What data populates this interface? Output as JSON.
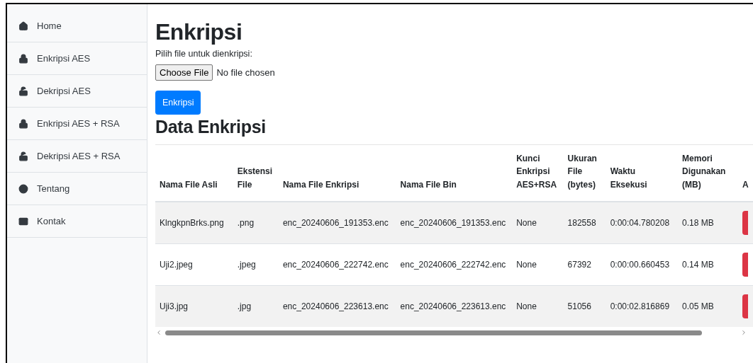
{
  "sidebar": {
    "items": [
      {
        "label": "Home"
      },
      {
        "label": "Enkripsi AES"
      },
      {
        "label": "Dekripsi AES"
      },
      {
        "label": "Enkripsi AES + RSA"
      },
      {
        "label": "Dekripsi AES + RSA"
      },
      {
        "label": "Tentang"
      },
      {
        "label": "Kontak"
      }
    ]
  },
  "main": {
    "title": "Enkripsi",
    "file_label": "Pilih file untuk dienkripsi:",
    "file_button": "Choose File",
    "file_status": "No file chosen",
    "submit": "Enkripsi"
  },
  "table": {
    "title": "Data Enkripsi",
    "columns": [
      "Nama File Asli",
      "Ekstensi File",
      "Nama File Enkripsi",
      "Nama File Bin",
      "Kunci Enkripsi AES+RSA",
      "Ukuran File (bytes)",
      "Waktu Eksekusi",
      "Memori Digunakan (MB)",
      "A"
    ],
    "rows": [
      [
        "KlngkpnBrks.png",
        ".png",
        "enc_20240606_191353.enc",
        "enc_20240606_191353.enc",
        "None",
        "182558",
        "0:00:04.780208",
        "0.18 MB"
      ],
      [
        "Uji2.jpeg",
        ".jpeg",
        "enc_20240606_222742.enc",
        "enc_20240606_222742.enc",
        "None",
        "67392",
        "0:00:00.660453",
        "0.14 MB"
      ],
      [
        "Uji3.jpg",
        ".jpg",
        "enc_20240606_223613.enc",
        "enc_20240606_223613.enc",
        "None",
        "51056",
        "0:00:02.816869",
        "0.05 MB"
      ]
    ]
  }
}
